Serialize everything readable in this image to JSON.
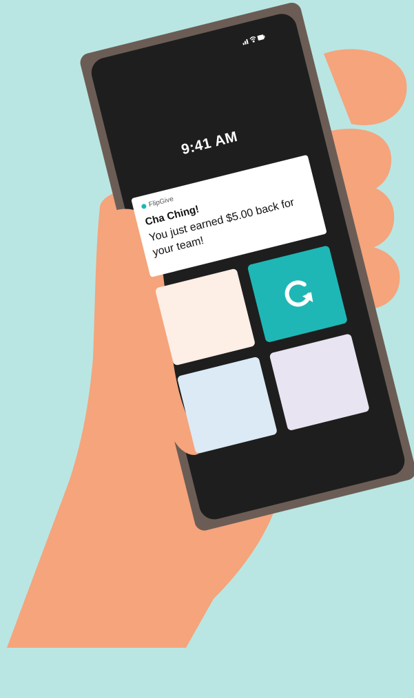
{
  "status_bar": {
    "time": "9:41 AM",
    "icons": [
      "signal-icon",
      "wifi-icon",
      "battery-icon"
    ]
  },
  "notification": {
    "app_name": "FlipGive",
    "title": "Cha Ching!",
    "body": "You just earned $5.00 back for your team!"
  },
  "app_grid": {
    "tiles": [
      {
        "name": "tile-peach",
        "color": "#fdeee6"
      },
      {
        "name": "tile-teal",
        "color": "#1eb7b5",
        "icon": "refresh-icon"
      },
      {
        "name": "tile-blue",
        "color": "#dbeaf5"
      },
      {
        "name": "tile-lavender",
        "color": "#e8e4f1"
      }
    ]
  },
  "colors": {
    "background": "#b9e6e3",
    "skin": "#f5a47c",
    "phone_frame": "#6b5d55",
    "screen": "#1e1e1e",
    "accent": "#1eb7b5"
  }
}
